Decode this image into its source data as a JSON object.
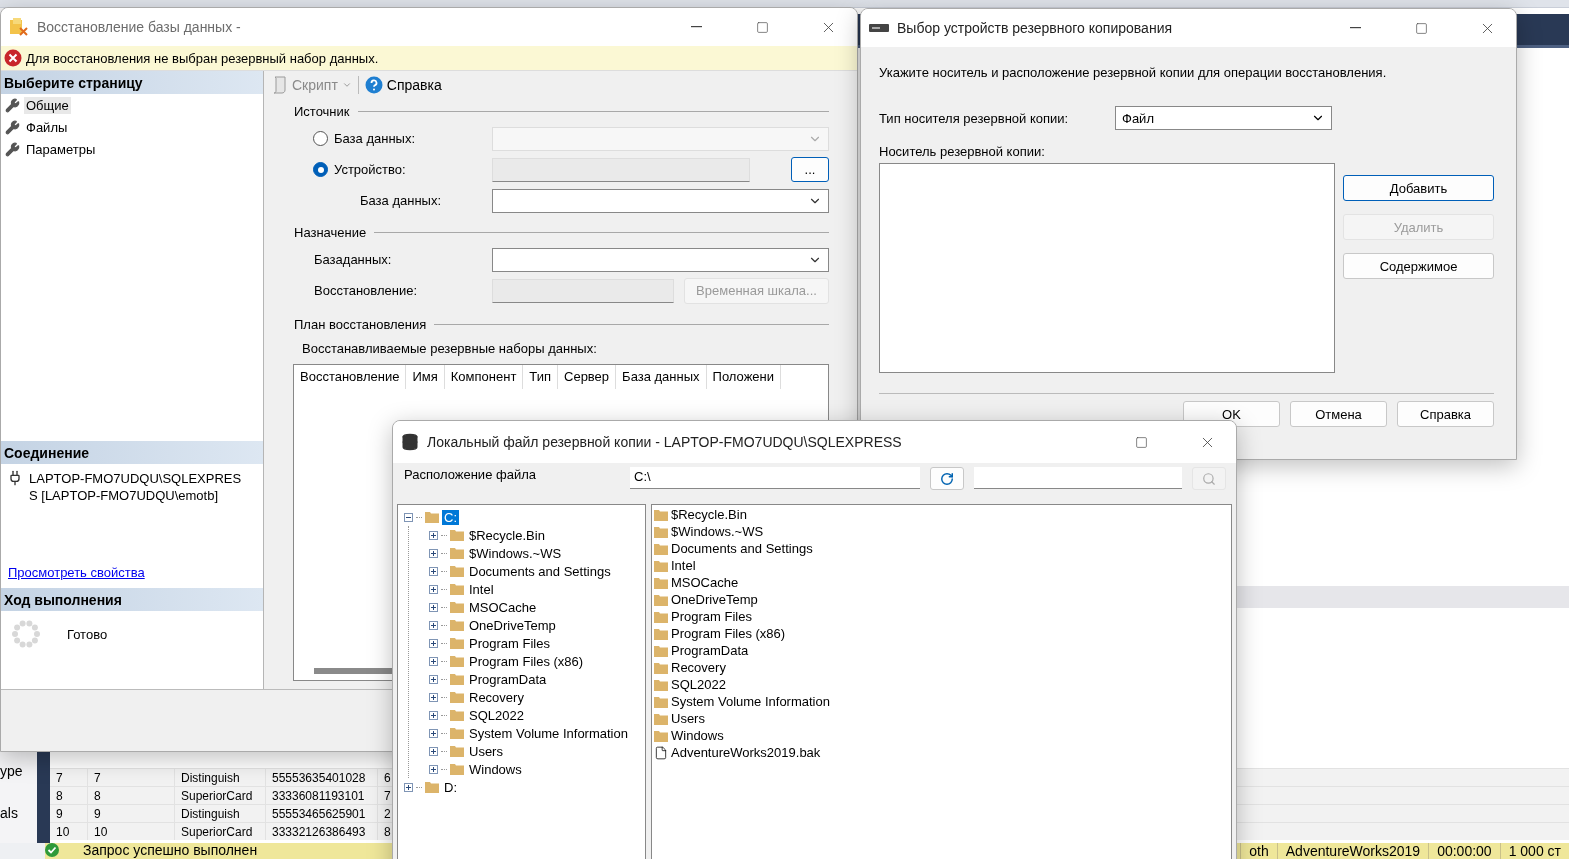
{
  "background": {
    "side_labels": [
      "ype",
      "als"
    ],
    "grid_rows": [
      [
        "7",
        "7",
        "Distinguish",
        "55553635401028",
        "6"
      ],
      [
        "8",
        "8",
        "SuperiorCard",
        "33336081193101",
        "7"
      ],
      [
        "9",
        "9",
        "Distinguish",
        "55553465625901",
        "2"
      ],
      [
        "10",
        "10",
        "SuperiorCard",
        "33332126386493",
        "8"
      ]
    ],
    "status_bar": {
      "message": "Запрос успешно выполнен",
      "cells": [
        "oth",
        "AdventureWorks2019",
        "00:00:00",
        "1 000 ст"
      ]
    }
  },
  "restore_window": {
    "title": "Восстановление базы данных -",
    "error": "Для восстановления не выбран резервный набор данных.",
    "pages_header": "Выберите страницу",
    "pages": [
      {
        "label": "Общие",
        "selected": true
      },
      {
        "label": "Файлы",
        "selected": false
      },
      {
        "label": "Параметры",
        "selected": false
      }
    ],
    "connection_header": "Соединение",
    "connection": "LAPTOP-FMO7UDQU\\SQLEXPRESS [LAPTOP-FMO7UDQU\\emotb]",
    "connection_link": "Просмотреть свойства",
    "progress_header": "Ход выполнения",
    "progress_status": "Готово",
    "toolbar": {
      "script": "Скрипт",
      "script_disabled": true,
      "help": "Справка"
    },
    "source": {
      "title": "Источник",
      "options": [
        {
          "label": "База данных:",
          "selected": false
        },
        {
          "label": "Устройство:",
          "selected": true
        }
      ],
      "browse": "...",
      "database_label": "База данных:"
    },
    "destination": {
      "title": "Назначение",
      "database_label": "Базаданных:",
      "restore_label": "Восстановление:",
      "timeline": "Временная шкала...",
      "timeline_disabled": true
    },
    "plan": {
      "title": "План восстановления",
      "grid_label": "Восстанавливаемые резервные наборы данных:",
      "columns": [
        "Восстановление",
        "Имя",
        "Компонент",
        "Тип",
        "Сервер",
        "База данных",
        "Положени"
      ]
    }
  },
  "device_window": {
    "title": "Выбор устройств резервного копирования",
    "instruction": "Укажите носитель и расположение резервной копии для операции восстановления.",
    "media_type_label": "Тип носителя резервной копии:",
    "media_type": "Файл",
    "media_label": "Носитель резервной копии:",
    "side_buttons": [
      {
        "label": "Добавить",
        "disabled": false,
        "default": true
      },
      {
        "label": "Удалить",
        "disabled": true,
        "default": false
      },
      {
        "label": "Содержимое",
        "disabled": false,
        "default": false
      }
    ],
    "footer_buttons": [
      "OK",
      "Отмена",
      "Справка"
    ]
  },
  "file_window": {
    "title": "Локальный файл резервной копии - LAPTOP-FMO7UDQU\\SQLEXPRESS",
    "location_label": "Расположение файла",
    "path": "C:\\",
    "tree": [
      {
        "label": "C:",
        "expanded": true,
        "selected": true,
        "children": [
          {
            "label": "$Recycle.Bin",
            "expanded": false,
            "selected": false
          },
          {
            "label": "$Windows.~WS",
            "expanded": false,
            "selected": false
          },
          {
            "label": "Documents and Settings",
            "expanded": false,
            "selected": false
          },
          {
            "label": "Intel",
            "expanded": false,
            "selected": false
          },
          {
            "label": "MSOCache",
            "expanded": false,
            "selected": false
          },
          {
            "label": "OneDriveTemp",
            "expanded": false,
            "selected": false
          },
          {
            "label": "Program Files",
            "expanded": false,
            "selected": false
          },
          {
            "label": "Program Files (x86)",
            "expanded": false,
            "selected": false
          },
          {
            "label": "ProgramData",
            "expanded": false,
            "selected": false
          },
          {
            "label": "Recovery",
            "expanded": false,
            "selected": false
          },
          {
            "label": "SQL2022",
            "expanded": false,
            "selected": false
          },
          {
            "label": "System Volume Information",
            "expanded": false,
            "selected": false
          },
          {
            "label": "Users",
            "expanded": false,
            "selected": false
          },
          {
            "label": "Windows",
            "expanded": false,
            "selected": false
          }
        ]
      },
      {
        "label": "D:",
        "expanded": false,
        "selected": false
      }
    ],
    "files": [
      {
        "name": "$Recycle.Bin",
        "kind": "folder"
      },
      {
        "name": "$Windows.~WS",
        "kind": "folder"
      },
      {
        "name": "Documents and Settings",
        "kind": "folder"
      },
      {
        "name": "Intel",
        "kind": "folder"
      },
      {
        "name": "MSOCache",
        "kind": "folder"
      },
      {
        "name": "OneDriveTemp",
        "kind": "folder"
      },
      {
        "name": "Program Files",
        "kind": "folder"
      },
      {
        "name": "Program Files (x86)",
        "kind": "folder"
      },
      {
        "name": "ProgramData",
        "kind": "folder"
      },
      {
        "name": "Recovery",
        "kind": "folder"
      },
      {
        "name": "SQL2022",
        "kind": "folder"
      },
      {
        "name": "System Volume Information",
        "kind": "folder"
      },
      {
        "name": "Users",
        "kind": "folder"
      },
      {
        "name": "Windows",
        "kind": "folder"
      },
      {
        "name": "AdventureWorks2019.bak",
        "kind": "file"
      }
    ]
  }
}
